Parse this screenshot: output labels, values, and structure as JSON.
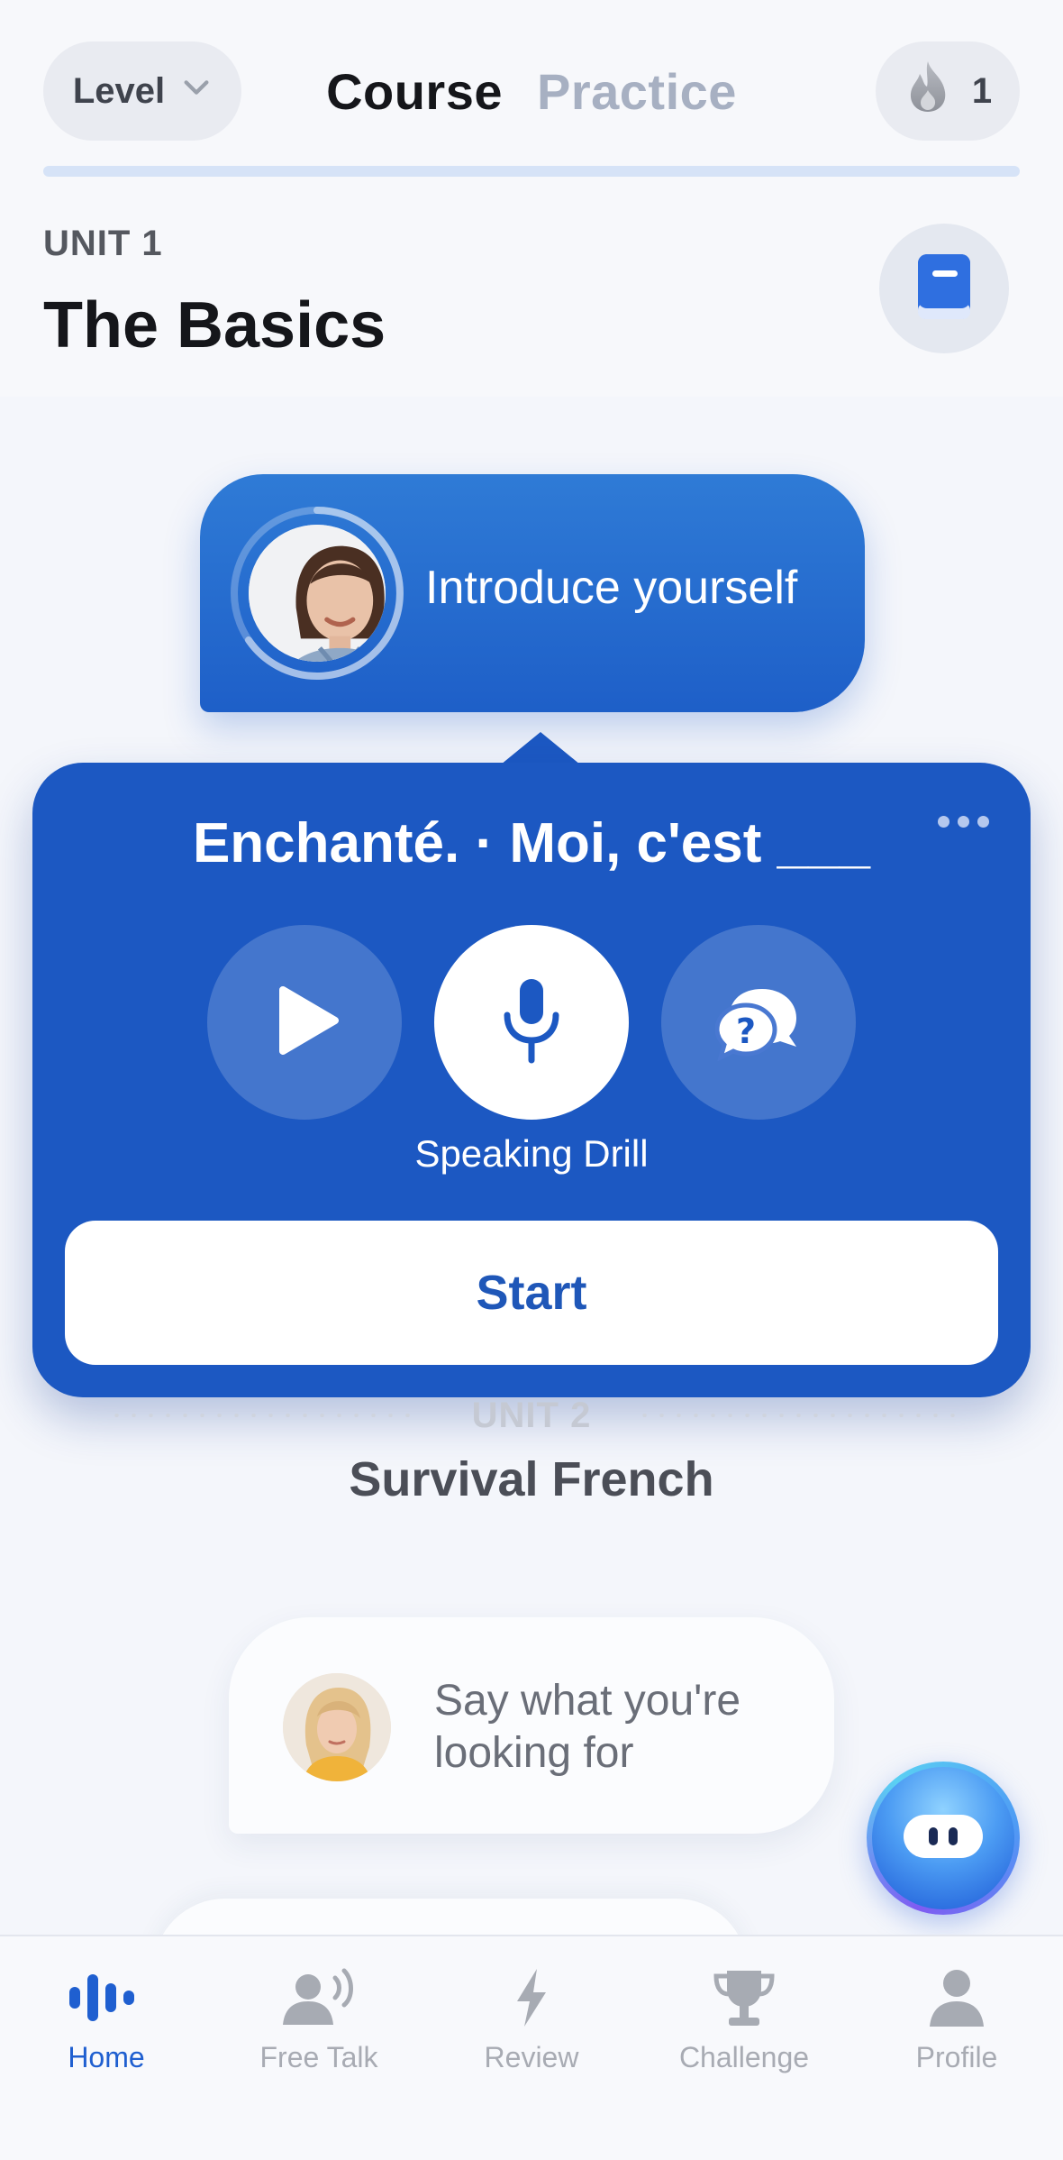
{
  "header": {
    "level_label": "Level",
    "tabs": [
      {
        "label": "Course",
        "active": true
      },
      {
        "label": "Practice",
        "active": false
      }
    ],
    "streak_count": "1",
    "progress_fraction": 0
  },
  "unit1": {
    "eyebrow": "UNIT 1",
    "title": "The Basics"
  },
  "lesson": {
    "title": "Introduce yourself"
  },
  "drill": {
    "phrase": "Enchanté. · Moi, c'est ___",
    "controls": [
      {
        "icon": "play-icon"
      },
      {
        "icon": "microphone-icon"
      },
      {
        "icon": "question-chat-icon"
      }
    ],
    "caption": "Speaking Drill",
    "start_label": "Start"
  },
  "unit2": {
    "eyebrow": "UNIT 2",
    "title": "Survival French"
  },
  "suggestion": {
    "text": "Say what you're looking for"
  },
  "nav": {
    "items": [
      {
        "label": "Home",
        "icon": "waveform-icon",
        "active": true
      },
      {
        "label": "Free Talk",
        "icon": "speaking-person-icon",
        "active": false
      },
      {
        "label": "Review",
        "icon": "lightning-icon",
        "active": false
      },
      {
        "label": "Challenge",
        "icon": "trophy-icon",
        "active": false
      },
      {
        "label": "Profile",
        "icon": "person-icon",
        "active": false
      }
    ]
  },
  "colors": {
    "primary": "#1c58c2",
    "accent_blue": "#1f5fd0",
    "inactive_tab": "#a7b0c2",
    "background": "#f4f6fb"
  }
}
